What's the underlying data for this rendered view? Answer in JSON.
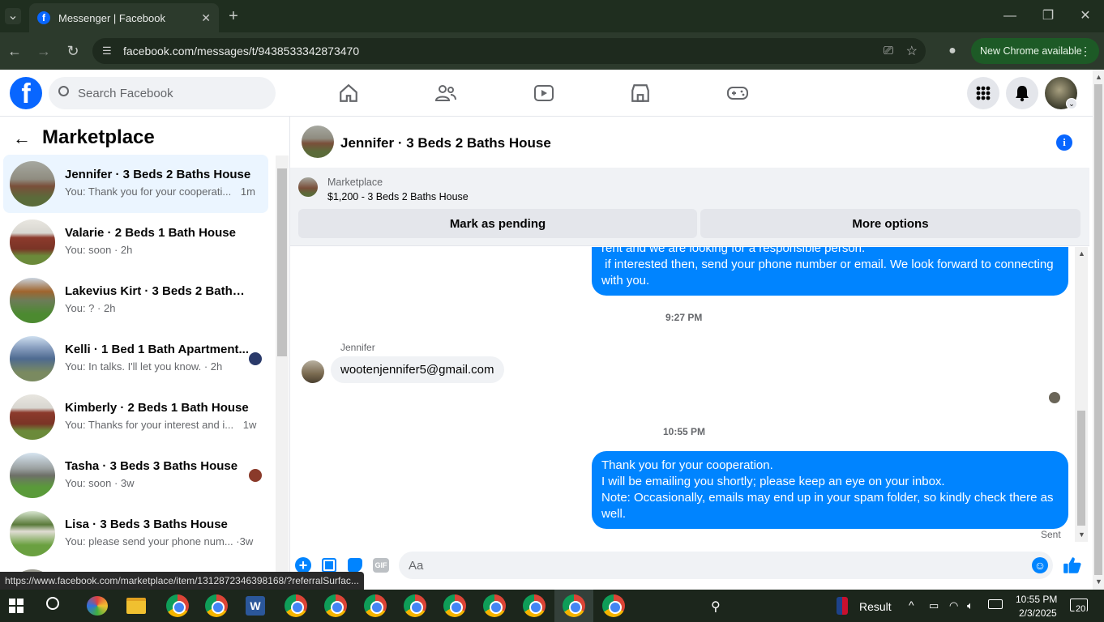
{
  "browser": {
    "tab_title": "Messenger | Facebook",
    "url": "facebook.com/messages/t/9438533342873470",
    "new_chrome_label": "New Chrome available"
  },
  "facebook": {
    "search_placeholder": "Search Facebook",
    "section_title": "Marketplace"
  },
  "conversations": [
    {
      "title": "Jennifer · 3 Beds 2 Baths House",
      "snippet": "You: Thank you for your cooperati...",
      "time": "1m"
    },
    {
      "title": "Valarie · 2 Beds 1 Bath House",
      "snippet": "You: soon",
      "time": "2h"
    },
    {
      "title": "Lakevius Kirt · 3 Beds 2 Baths H...",
      "snippet": "You: ?",
      "time": "2h"
    },
    {
      "title": "Kelli · 1 Bed 1 Bath Apartment...",
      "snippet": "You: In talks. I'll let you know.",
      "time": "2h"
    },
    {
      "title": "Kimberly · 2 Beds 1 Bath House",
      "snippet": "You: Thanks for your interest and i...",
      "time": "1w"
    },
    {
      "title": "Tasha · 3 Beds 3 Baths House",
      "snippet": "You: soon",
      "time": "3w"
    },
    {
      "title": "Lisa · 3 Beds 3 Baths House",
      "snippet": "You: please send your phone num...",
      "time": "3w"
    }
  ],
  "chat": {
    "title": "Jennifer · 3 Beds 2 Baths House",
    "listing_label": "Marketplace",
    "listing_detail": "$1,200 - 3 Beds 2 Baths House",
    "mark_pending": "Mark as pending",
    "more_options": "More options",
    "msg1_line1": "rent and we are looking for a responsible person.",
    "msg1_line2": " if interested then, send your phone number or email. We look forward to connecting",
    "msg1_line3": "with you.",
    "time1": "9:27 PM",
    "sender_name": "Jennifer",
    "msg_in": "wootenjennifer5@gmail.com",
    "time2": "10:55 PM",
    "msg2_line1": "Thank you for your cooperation.",
    "msg2_line2": "I will be emailing you shortly; please keep an eye on your inbox.",
    "msg2_line3": "Note: Occasionally, emails may end up in your spam folder, so kindly check there as",
    "msg2_line4": "well.",
    "sent_label": "Sent",
    "composer_placeholder": "Aa",
    "gif_label": "GIF"
  },
  "status_url": "https://www.facebook.com/marketplace/item/1312872346398168/?referralSurfac...",
  "taskbar": {
    "weather_label": "Result",
    "time": "10:55 PM",
    "date": "2/3/2025",
    "notif_count": "20"
  },
  "colors": {
    "accent": "#0084ff",
    "fb_blue": "#0866ff"
  }
}
